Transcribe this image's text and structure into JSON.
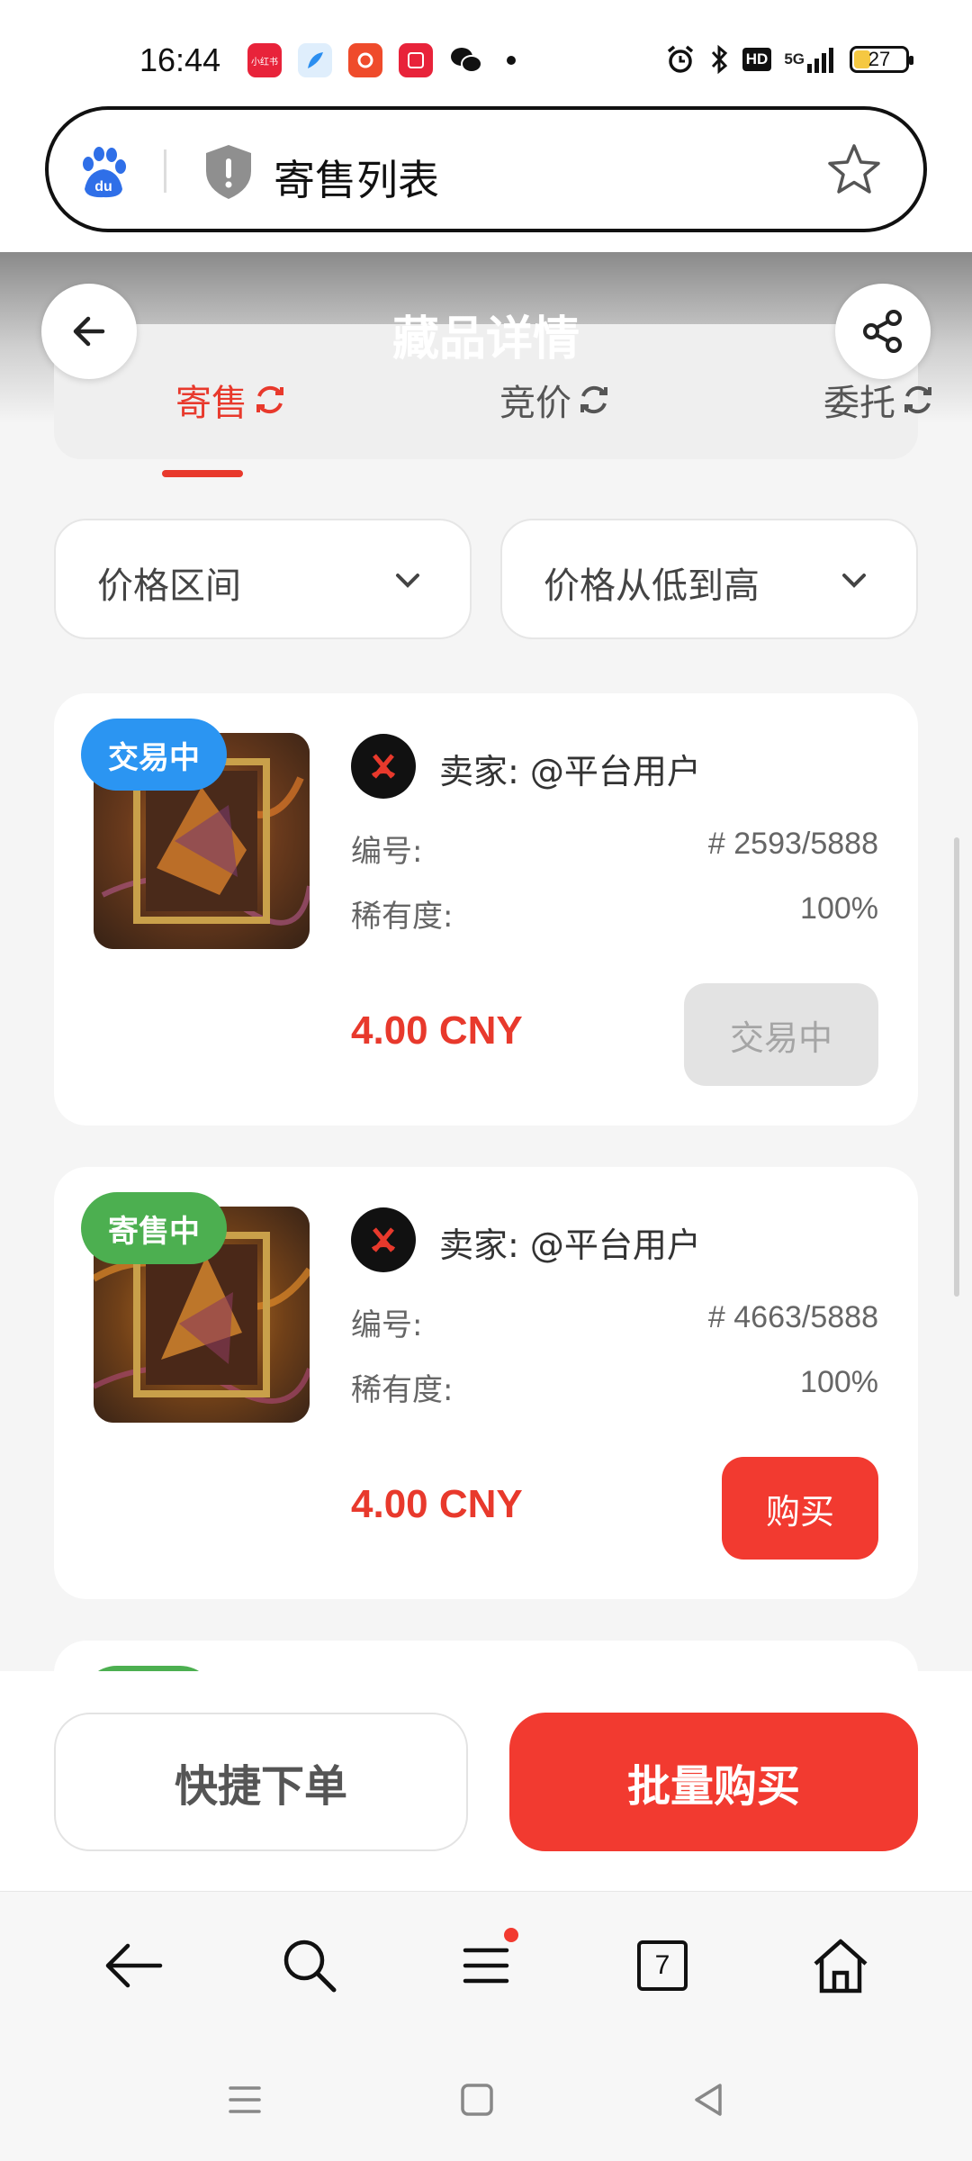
{
  "status_bar": {
    "time": "16:44",
    "notifications": [
      {
        "icon": "xiaohongshu-icon",
        "label": "小红书",
        "color": "#e8233a"
      },
      {
        "icon": "feather-app-icon",
        "label": "",
        "color": "#2b8ef0"
      },
      {
        "icon": "shopping-app-icon",
        "label": "",
        "color": "#ef4b2b"
      },
      {
        "icon": "taobao-event-icon",
        "label": "",
        "color": "#e8233a"
      },
      {
        "icon": "wechat-icon",
        "label": "",
        "color": "#111111"
      }
    ],
    "network": "5G",
    "hd_label": "HD",
    "battery": "27"
  },
  "browser": {
    "address_title": "寄售列表",
    "logo": "baidu-logo",
    "shield": "shield-icon",
    "favorite": "star-icon"
  },
  "page": {
    "title": "藏品详情",
    "tabs": [
      {
        "label": "寄售",
        "active": true
      },
      {
        "label": "竞价",
        "active": false
      },
      {
        "label": "委托",
        "active": false
      }
    ],
    "filters": [
      {
        "label": "价格区间"
      },
      {
        "label": "价格从低到高"
      }
    ]
  },
  "listings": [
    {
      "badge": "交易中",
      "badge_color": "#2b95f2",
      "seller": "卖家: @平台用户",
      "number_label": "编号:",
      "number_value": "# 2593/5888",
      "rarity_label": "稀有度:",
      "rarity_value": "100%",
      "price": "4.00 CNY",
      "action": "交易中",
      "action_enabled": false
    },
    {
      "badge": "寄售中",
      "badge_color": "#4caf50",
      "seller": "卖家: @平台用户",
      "number_label": "编号:",
      "number_value": "# 4663/5888",
      "rarity_label": "稀有度:",
      "rarity_value": "100%",
      "price": "4.00 CNY",
      "action": "购买",
      "action_enabled": true
    }
  ],
  "actions": {
    "quick_order": "快捷下单",
    "batch_buy": "批量购买"
  },
  "browser_nav": {
    "tab_count": "7"
  },
  "colors": {
    "accent_red": "#e8392c",
    "buy_red": "#f23a30",
    "badge_blue": "#2b95f2",
    "badge_green": "#4caf50"
  }
}
